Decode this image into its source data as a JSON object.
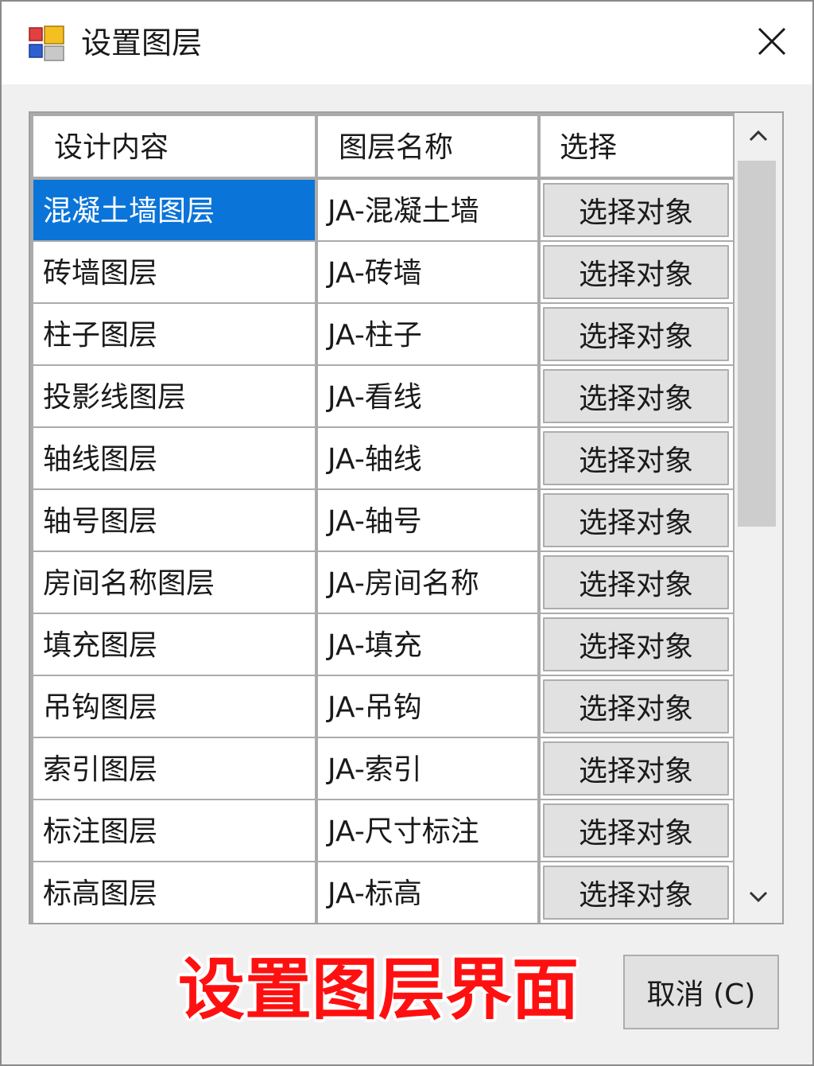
{
  "window": {
    "title": "设置图层",
    "close_icon": "close-icon",
    "app_icon": "app-icon"
  },
  "grid": {
    "columns": [
      "设计内容",
      "图层名称",
      "选择"
    ],
    "selected_row": 0,
    "rows": [
      {
        "content": "混凝土墙图层",
        "layer": "JA-混凝土墙",
        "action": "选择对象"
      },
      {
        "content": "砖墙图层",
        "layer": "JA-砖墙",
        "action": "选择对象"
      },
      {
        "content": "柱子图层",
        "layer": "JA-柱子",
        "action": "选择对象"
      },
      {
        "content": "投影线图层",
        "layer": "JA-看线",
        "action": "选择对象"
      },
      {
        "content": "轴线图层",
        "layer": "JA-轴线",
        "action": "选择对象"
      },
      {
        "content": "轴号图层",
        "layer": "JA-轴号",
        "action": "选择对象"
      },
      {
        "content": "房间名称图层",
        "layer": "JA-房间名称",
        "action": "选择对象"
      },
      {
        "content": "填充图层",
        "layer": "JA-填充",
        "action": "选择对象"
      },
      {
        "content": "吊钩图层",
        "layer": "JA-吊钩",
        "action": "选择对象"
      },
      {
        "content": "索引图层",
        "layer": "JA-索引",
        "action": "选择对象"
      },
      {
        "content": "标注图层",
        "layer": "JA-尺寸标注",
        "action": "选择对象"
      },
      {
        "content": "标高图层",
        "layer": "JA-标高",
        "action": "选择对象"
      }
    ]
  },
  "footer": {
    "caption": "设置图层界面",
    "cancel_label": "取消 (C)"
  },
  "colors": {
    "selection": "#0a74d9",
    "caption": "#ff1010"
  }
}
